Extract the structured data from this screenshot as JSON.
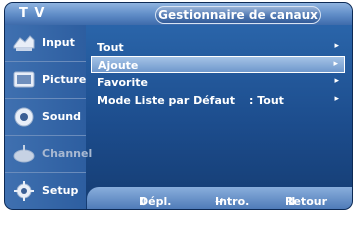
{
  "header": {
    "tv_label": "T V",
    "title": "Gestionnaire de canaux"
  },
  "sidebar": {
    "items": [
      {
        "label": "Input",
        "icon": "input-icon"
      },
      {
        "label": "Picture",
        "icon": "picture-icon"
      },
      {
        "label": "Sound",
        "icon": "sound-icon"
      },
      {
        "label": "Channel",
        "icon": "channel-icon",
        "dim": true
      },
      {
        "label": "Setup",
        "icon": "setup-icon"
      }
    ]
  },
  "menu": {
    "items": [
      {
        "label": "Tout",
        "value": "",
        "arrow": "▸"
      },
      {
        "label": "Ajoute",
        "value": "",
        "arrow": "▸",
        "selected": true
      },
      {
        "label": "Favorite",
        "value": "",
        "arrow": "▸"
      },
      {
        "label": "Mode Liste par Défaut",
        "value": ": Tout",
        "arrow": "▸"
      }
    ]
  },
  "footer": {
    "move": "Dépl.",
    "enter": "Intro.",
    "return": "Retour"
  },
  "colors": {
    "panel": "#1c4c8c",
    "header": "#5e8bc6",
    "selected": "#8fb3df"
  }
}
